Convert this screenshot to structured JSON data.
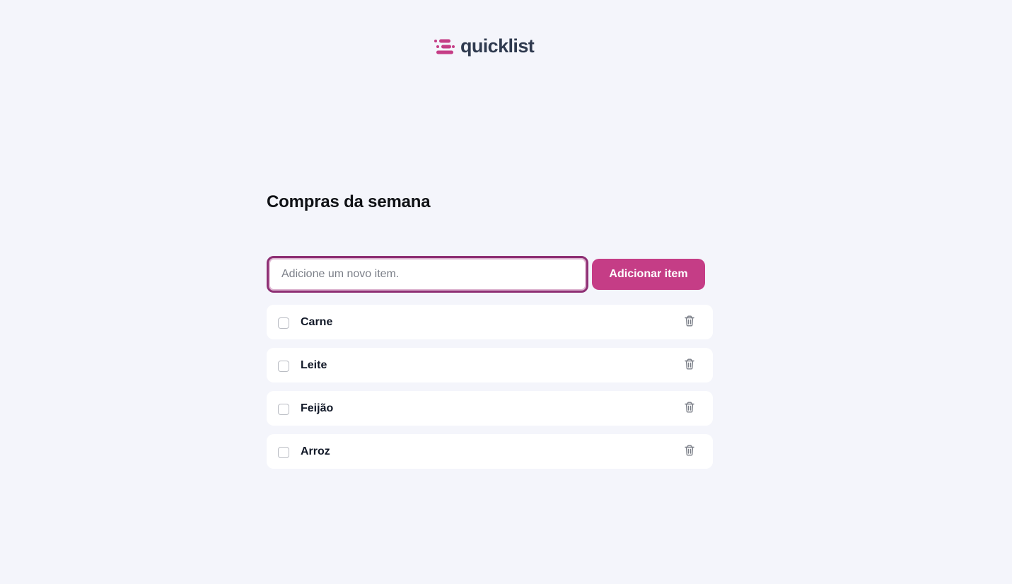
{
  "brand": {
    "name": "quicklist",
    "logo_icon": "list-lines-icon",
    "accent": "#c53d86",
    "text_color": "#2f3a4f"
  },
  "page": {
    "title": "Compras da semana"
  },
  "form": {
    "input_placeholder": "Adicione um novo item.",
    "input_value": "",
    "button_label": "Adicionar item"
  },
  "items": [
    {
      "label": "Carne",
      "checked": false,
      "checkbox_icon": "checkbox-icon",
      "delete_icon": "trash-icon"
    },
    {
      "label": "Leite",
      "checked": false,
      "checkbox_icon": "checkbox-icon",
      "delete_icon": "trash-icon"
    },
    {
      "label": "Feijão",
      "checked": false,
      "checkbox_icon": "checkbox-icon",
      "delete_icon": "trash-icon"
    },
    {
      "label": "Arroz",
      "checked": false,
      "checkbox_icon": "checkbox-icon",
      "delete_icon": "trash-icon"
    }
  ]
}
